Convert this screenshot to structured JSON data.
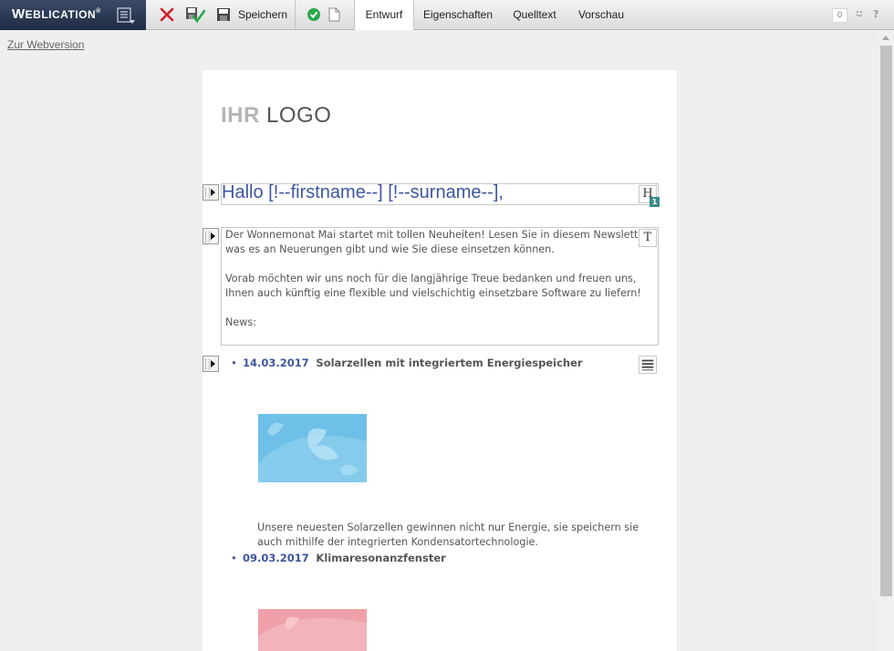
{
  "toolbar": {
    "brand_first": "W",
    "brand_rest": "EBLICATION",
    "brand_mark": "®",
    "save_label": "Speichern",
    "tabs": [
      {
        "label": "Entwurf",
        "active": true
      },
      {
        "label": "Eigenschaften",
        "active": false
      },
      {
        "label": "Quelltext",
        "active": false
      },
      {
        "label": "Vorschau",
        "active": false
      }
    ],
    "counter": "0",
    "help": "?"
  },
  "web_link": "Zur Webversion",
  "page": {
    "logo_bold": "IHR",
    "logo_light": "LOGO",
    "headline": "Hallo [!--firstname--] [!--surname--],",
    "headline_badge": "1",
    "intro_lines": [
      "Der Wonnemonat Mai startet mit tollen Neuheiten! Lesen Sie in diesem Newsletter,",
      "was es an Neuerungen gibt und wie Sie diese einsetzen können."
    ],
    "thanks_lines": [
      "Vorab möchten wir uns noch für die langjährige Treue bedanken und freuen uns,",
      "Ihnen auch künftig eine flexible und vielschichtig einsetzbare Software zu liefern!"
    ],
    "news_label": "News:",
    "news": [
      {
        "date": "14.03.2017",
        "title": "Solarzellen mit integriertem Energiespeicher",
        "image_color": "#6fc0e8",
        "description_lines": [
          "Unsere neuesten Solarzellen gewinnen nicht nur Energie, sie speichern sie",
          "auch mithilfe der integrierten Kondensatortechnologie."
        ]
      },
      {
        "date": "09.03.2017",
        "title": "Klimaresonanzfenster",
        "image_color": "#f0a0a8"
      }
    ]
  },
  "colors": {
    "accent": "#3d56a0",
    "brand_bg": "#263552",
    "badge": "#3b8a8a"
  }
}
